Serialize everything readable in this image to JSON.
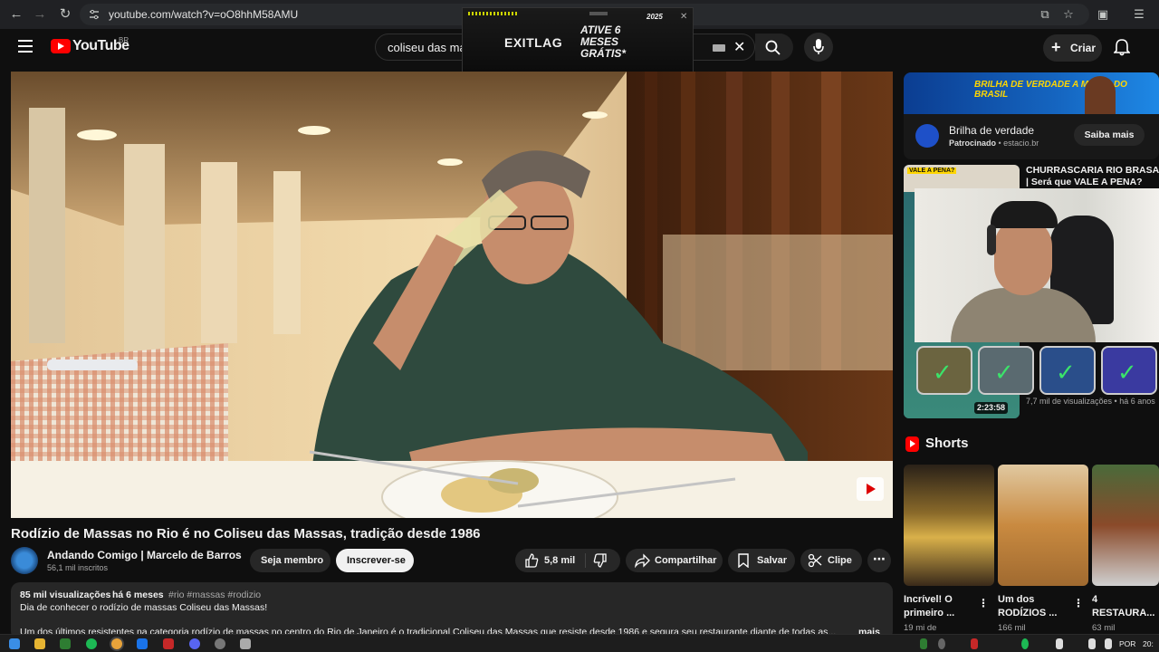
{
  "browser": {
    "url": "youtube.com/watch?v=oO8hhM58AMU"
  },
  "header": {
    "logo_text": "YouTube",
    "country": "BR",
    "search_value": "coliseu das ma",
    "create_label": "Criar"
  },
  "overlay_ad": {
    "brand": "EXITLAG",
    "offer": "ATIVE 6 MESES GRÁTIS*",
    "year": "2025"
  },
  "video": {
    "title": "Rodízio de Massas no Rio é no Coliseu das Massas, tradição desde 1986",
    "channel_name": "Andando Comigo | Marcelo de Barros",
    "subscribers": "56,1 mil inscritos",
    "member_label": "Seja membro",
    "subscribe_label": "Inscrever-se",
    "likes": "5,8 mil",
    "share_label": "Compartilhar",
    "save_label": "Salvar",
    "clip_label": "Clipe"
  },
  "description": {
    "views": "85 mil visualizações",
    "age": "há 6 meses",
    "tags": "#rio #massas #rodizio",
    "line1": "Dia de conhecer o rodízio de massas Coliseu das Massas!",
    "line2": "Um dos últimos resistentes na categoria rodízio de massas no centro do Rio de Janeiro é o tradicional Coliseu das Massas que resiste desde 1986 e segura seu restaurante diante de todas as...",
    "more": "mais"
  },
  "sidebar": {
    "ad": {
      "banner": "BRILHA DE VERDADE A MAIOR DO BRASIL",
      "title": "Brilha de verdade",
      "sponsored": "Patrocinado",
      "domain": "estacio.br",
      "cta": "Saiba mais"
    },
    "rec": {
      "title": "CHURRASCARIA RIO BRASA | Será que VALE A PENA?",
      "thumb_text": "VALE A PENA?",
      "duration": "2:23:58",
      "meta": "7,7 mil de visualizações • há 6 anos"
    },
    "shorts_heading": "Shorts",
    "shorts": [
      {
        "title": "Incrível! O",
        "title2": "primeiro ...",
        "views": "19 mi de"
      },
      {
        "title": "Um dos",
        "title2": "RODÍZIOS ...",
        "views": "166 mil"
      },
      {
        "title": "4",
        "title2": "RESTAURA...",
        "views": "63 mil"
      }
    ]
  },
  "taskbar": {
    "lang": "POR",
    "time": "20:"
  }
}
